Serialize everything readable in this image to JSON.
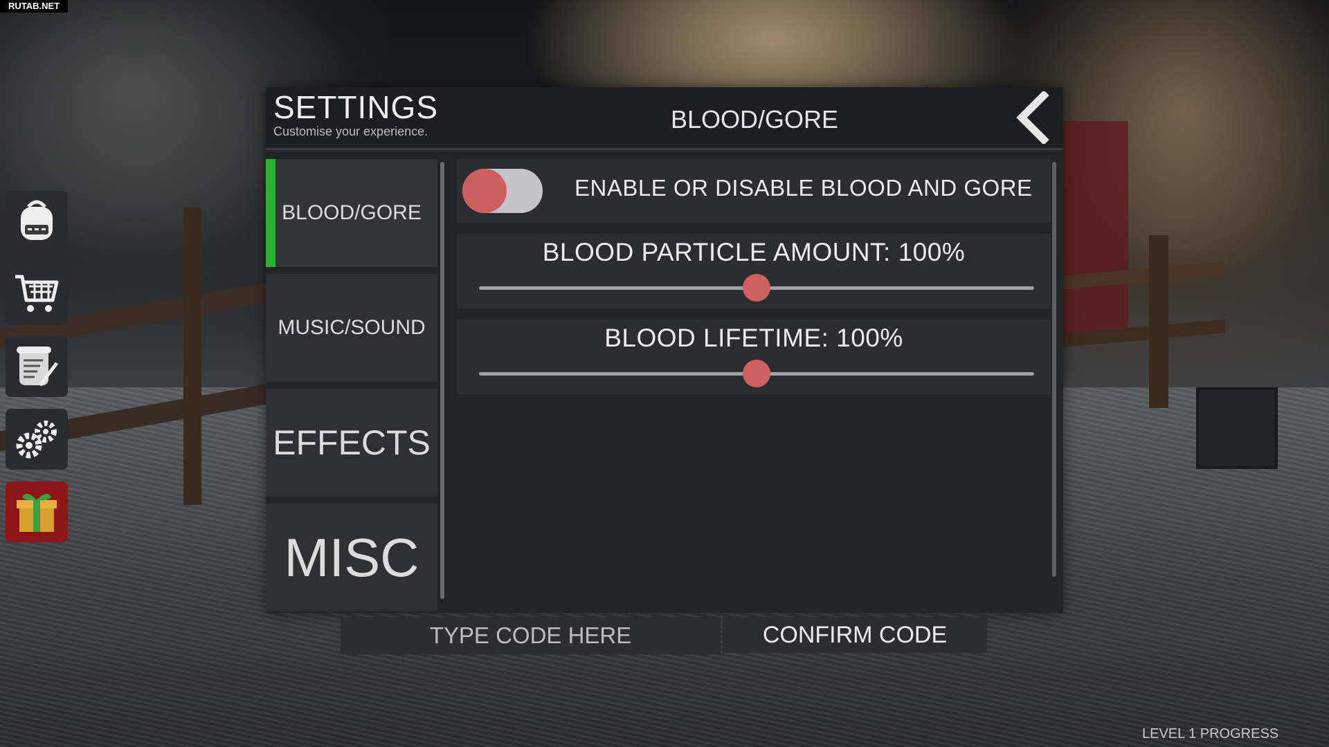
{
  "watermark": "RUTAB.NET",
  "settings": {
    "title": "SETTINGS",
    "subtitle": "Customise your experience.",
    "section_title": "BLOOD/GORE",
    "tabs": [
      {
        "label": "BLOOD/GORE",
        "active": true
      },
      {
        "label": "MUSIC/SOUND",
        "active": false
      },
      {
        "label": "EFFECTS",
        "active": false
      },
      {
        "label": "MISC",
        "active": false
      }
    ],
    "options": {
      "toggle_label": "ENABLE OR DISABLE BLOOD AND GORE",
      "particle_label": "BLOOD PARTICLE AMOUNT: 100%",
      "particle_value": 0.5,
      "lifetime_label": "BLOOD LIFETIME: 100%",
      "lifetime_value": 0.5
    }
  },
  "code": {
    "placeholder": "TYPE CODE HERE",
    "confirm_label": "CONFIRM CODE"
  },
  "hud": {
    "icons": [
      "backpack-icon",
      "cart-icon",
      "scroll-icon",
      "gears-icon",
      "gift-icon"
    ]
  },
  "level_progress": "LEVEL 1 PROGRESS",
  "colors": {
    "accent_green": "#2db02d",
    "toggle_knob": "#cf5f5f",
    "gift_bg": "#8d1616"
  }
}
